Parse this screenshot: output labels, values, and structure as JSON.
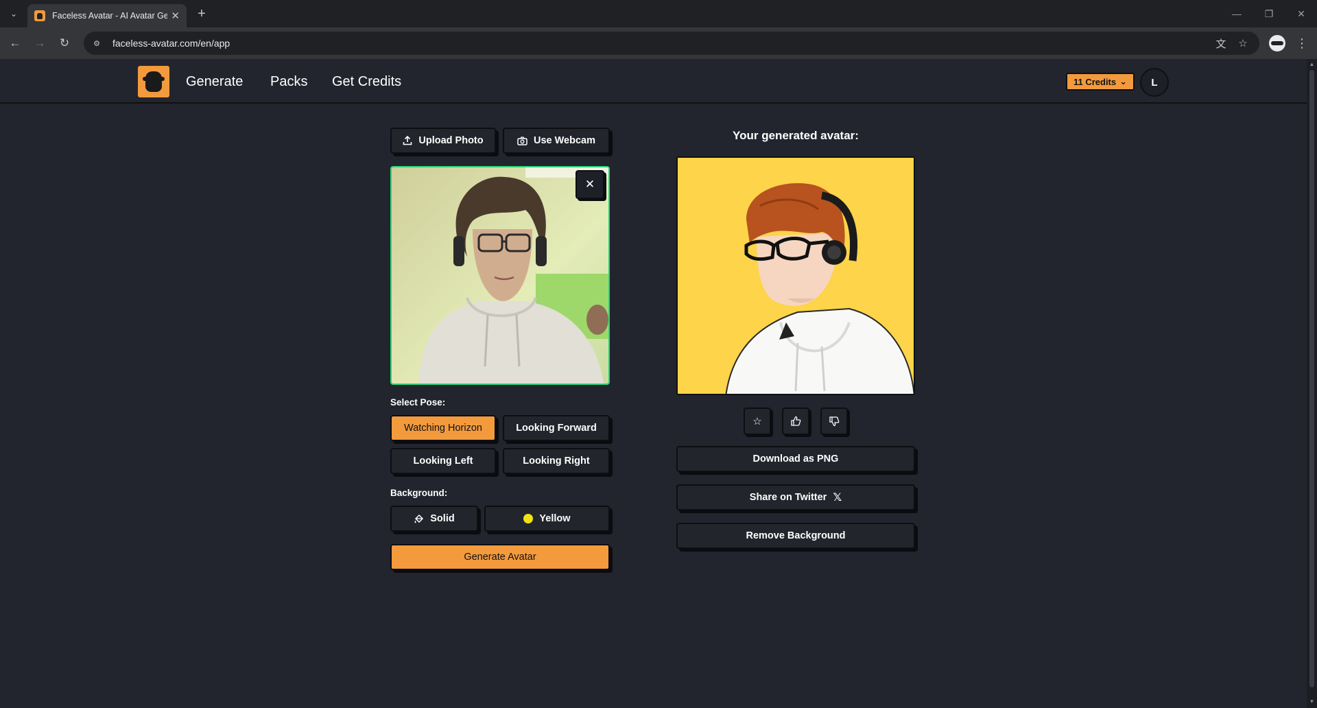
{
  "browser": {
    "tab_title": "Faceless Avatar - AI Avatar Gen",
    "url": "faceless-avatar.com/en/app",
    "tab_dropdown_icon": "chevron-down-icon",
    "close_tab_symbol": "✕",
    "new_tab_symbol": "+",
    "back_symbol": "←",
    "forward_symbol": "→",
    "reload_symbol": "↻",
    "minimize_symbol": "—",
    "restore_symbol": "❐",
    "close_window_symbol": "✕",
    "translate_symbol": "文",
    "bookmark_symbol": "☆",
    "menu_symbol": "⋮"
  },
  "header": {
    "nav": [
      "Generate",
      "Packs",
      "Get Credits"
    ],
    "credits_label": "11 Credits",
    "credits_caret": "⌄",
    "user_initial": "L",
    "brand_color": "#f39a3d"
  },
  "left": {
    "upload_label": "Upload Photo",
    "webcam_label": "Use Webcam",
    "close_symbol": "✕",
    "pose_label": "Select Pose:",
    "poses": [
      "Watching Horizon",
      "Looking Forward",
      "Looking Left",
      "Looking Right"
    ],
    "selected_pose": "Watching Horizon",
    "background_label": "Background:",
    "bg_type": "Solid",
    "bg_color": "Yellow",
    "generate_label": "Generate Avatar"
  },
  "right": {
    "title": "Your generated avatar:",
    "download_label": "Download as PNG",
    "share_label": "Share on Twitter",
    "share_icon_symbol": "𝕏",
    "remove_bg_label": "Remove Background",
    "favorite_symbol": "☆",
    "like_symbol": "👍",
    "dislike_symbol": "👎"
  }
}
